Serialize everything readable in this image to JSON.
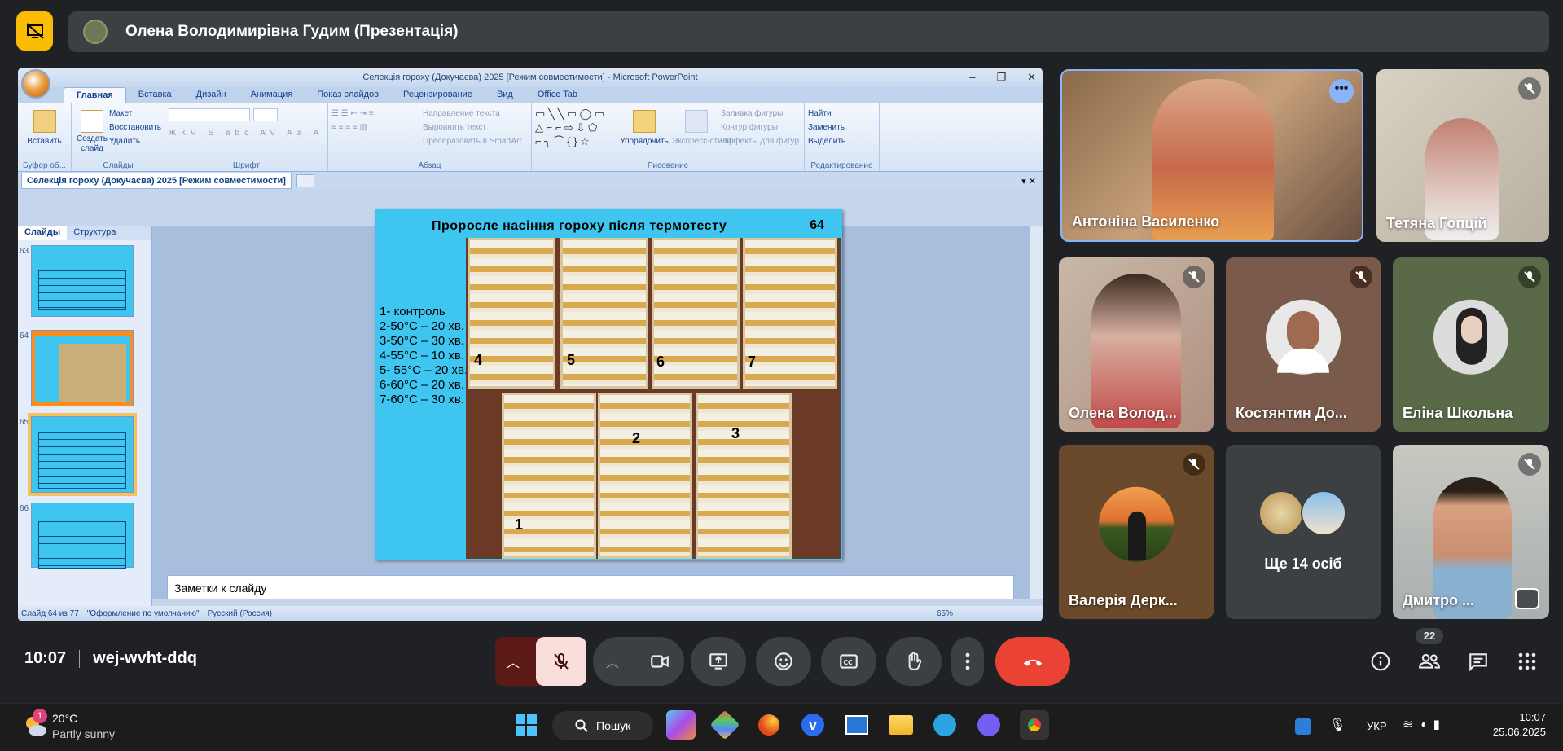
{
  "meet": {
    "presenter_bar": "Олена Володимирівна Гудим (Презентація)",
    "time": "10:07",
    "meeting_code": "wej-wvht-ddq",
    "participant_count": "22"
  },
  "ppt": {
    "title": "Селекція гороху (Докучаєва) 2025 [Режим совместимости] - Microsoft PowerPoint",
    "tabs": [
      "Главная",
      "Вставка",
      "Дизайн",
      "Анимация",
      "Показ слайдов",
      "Рецензирование",
      "Вид",
      "Office Tab"
    ],
    "groups": {
      "clipboard": {
        "label": "Буфер об...",
        "paste": "Вставить"
      },
      "slides": {
        "label": "Слайды",
        "create": "Создать слайд",
        "layout": "Макет",
        "restore": "Восстановить",
        "delete": "Удалить"
      },
      "font": {
        "label": "Шрифт"
      },
      "paragraph": {
        "label": "Абзац",
        "direction": "Направление текста",
        "align": "Выровнять текст",
        "smartart": "Преобразовать в SmartArt"
      },
      "drawing": {
        "label": "Рисование",
        "arrange": "Упорядочить",
        "styles": "Экспресс-стили",
        "fill": "Заливка фигуры",
        "outline": "Контур фигуры",
        "effects": "Эффекты для фигур"
      },
      "editing": {
        "label": "Редактирование",
        "find": "Найти",
        "replace": "Заменить",
        "select": "Выделить"
      }
    },
    "doc_tab": "Селекція гороху (Докучаєва) 2025 [Режим совместимости]",
    "pane_tabs": [
      "Слайды",
      "Структура"
    ],
    "thumb_numbers": [
      "63",
      "64",
      "65",
      "66"
    ],
    "notes_placeholder": "Заметки к слайду",
    "status": {
      "slide": "Слайд 64 из 77",
      "theme": "\"Оформление по умолчанию\"",
      "lang": "Русский (Россия)",
      "zoom": "65%"
    }
  },
  "slide": {
    "title": "Проросле насіння  гороху після термотесту",
    "number": "64",
    "list": [
      "1- контроль",
      "2-50°С – 20 хв.",
      "3-50°С – 30 хв.",
      "4-55°С – 10 хв.",
      "5- 55°С – 20 хв.",
      "6-60°С – 20 хв.",
      "7-60°С – 30 хв."
    ],
    "tray_labels": [
      "4",
      "5",
      "6",
      "7",
      "2",
      "3",
      "1"
    ]
  },
  "participants": [
    {
      "name": "Антоніна Василенко"
    },
    {
      "name": "Тетяна Гопцій"
    },
    {
      "name": "Олена Волод..."
    },
    {
      "name": "Костянтин До..."
    },
    {
      "name": "Еліна Школьна"
    },
    {
      "name": "Валерія Дерк..."
    },
    {
      "name": "Ще 14 осіб"
    },
    {
      "name": "Дмитро ..."
    }
  ],
  "taskbar": {
    "weather_temp": "20°C",
    "weather_desc": "Partly sunny",
    "weather_badge": "1",
    "search": "Пошук",
    "lang": "УКР",
    "clock_time": "10:07",
    "clock_date": "25.06.2025"
  },
  "colors": {
    "accent_red": "#ea4335",
    "presenter_yellow": "#fbbc04",
    "slide_bg": "#3fc6f0"
  }
}
